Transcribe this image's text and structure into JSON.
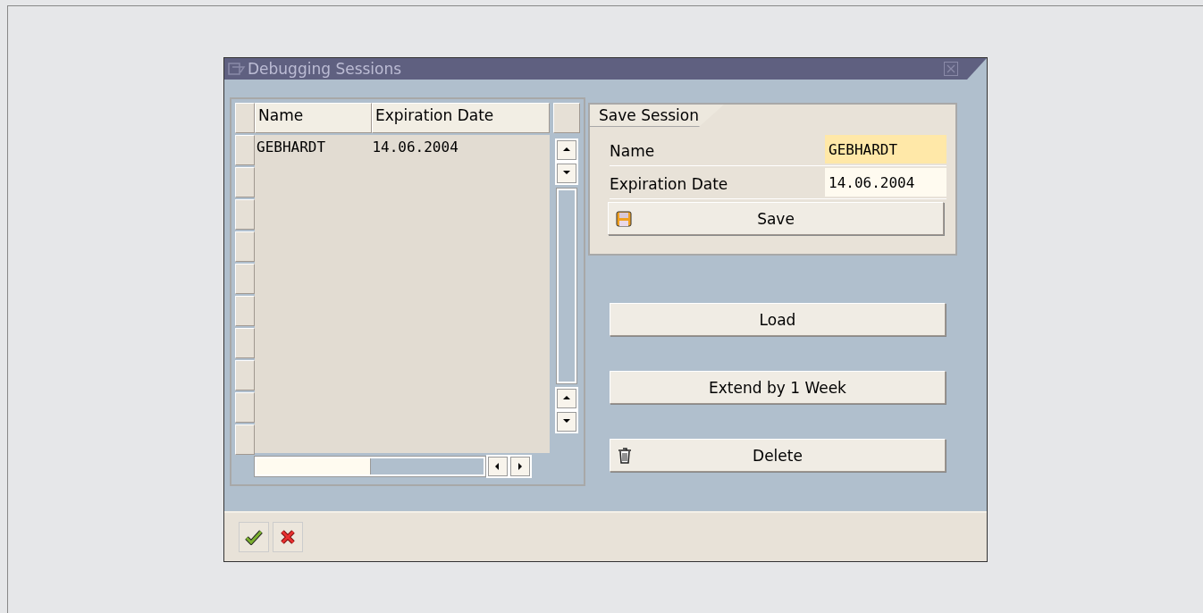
{
  "window": {
    "title": "Debugging Sessions"
  },
  "table": {
    "columns": [
      "Name",
      "Expiration Date"
    ],
    "rows": [
      [
        "GEBHARDT",
        "14.06.2004"
      ]
    ]
  },
  "save_session": {
    "title": "Save Session",
    "fields": [
      {
        "label": "Name",
        "value": "GEBHARDT",
        "focused": true
      },
      {
        "label": "Expiration Date",
        "value": "14.06.2004",
        "focused": false
      }
    ],
    "button": {
      "label": "Save",
      "kind": "save"
    }
  },
  "buttons": [
    {
      "label": "Load",
      "kind": "plain"
    },
    {
      "label": "Extend by 1 Week",
      "kind": "plain"
    },
    {
      "label": "Delete",
      "kind": "delete"
    }
  ],
  "footer_buttons": [
    {
      "kind": "confirm"
    },
    {
      "kind": "cancel"
    }
  ]
}
